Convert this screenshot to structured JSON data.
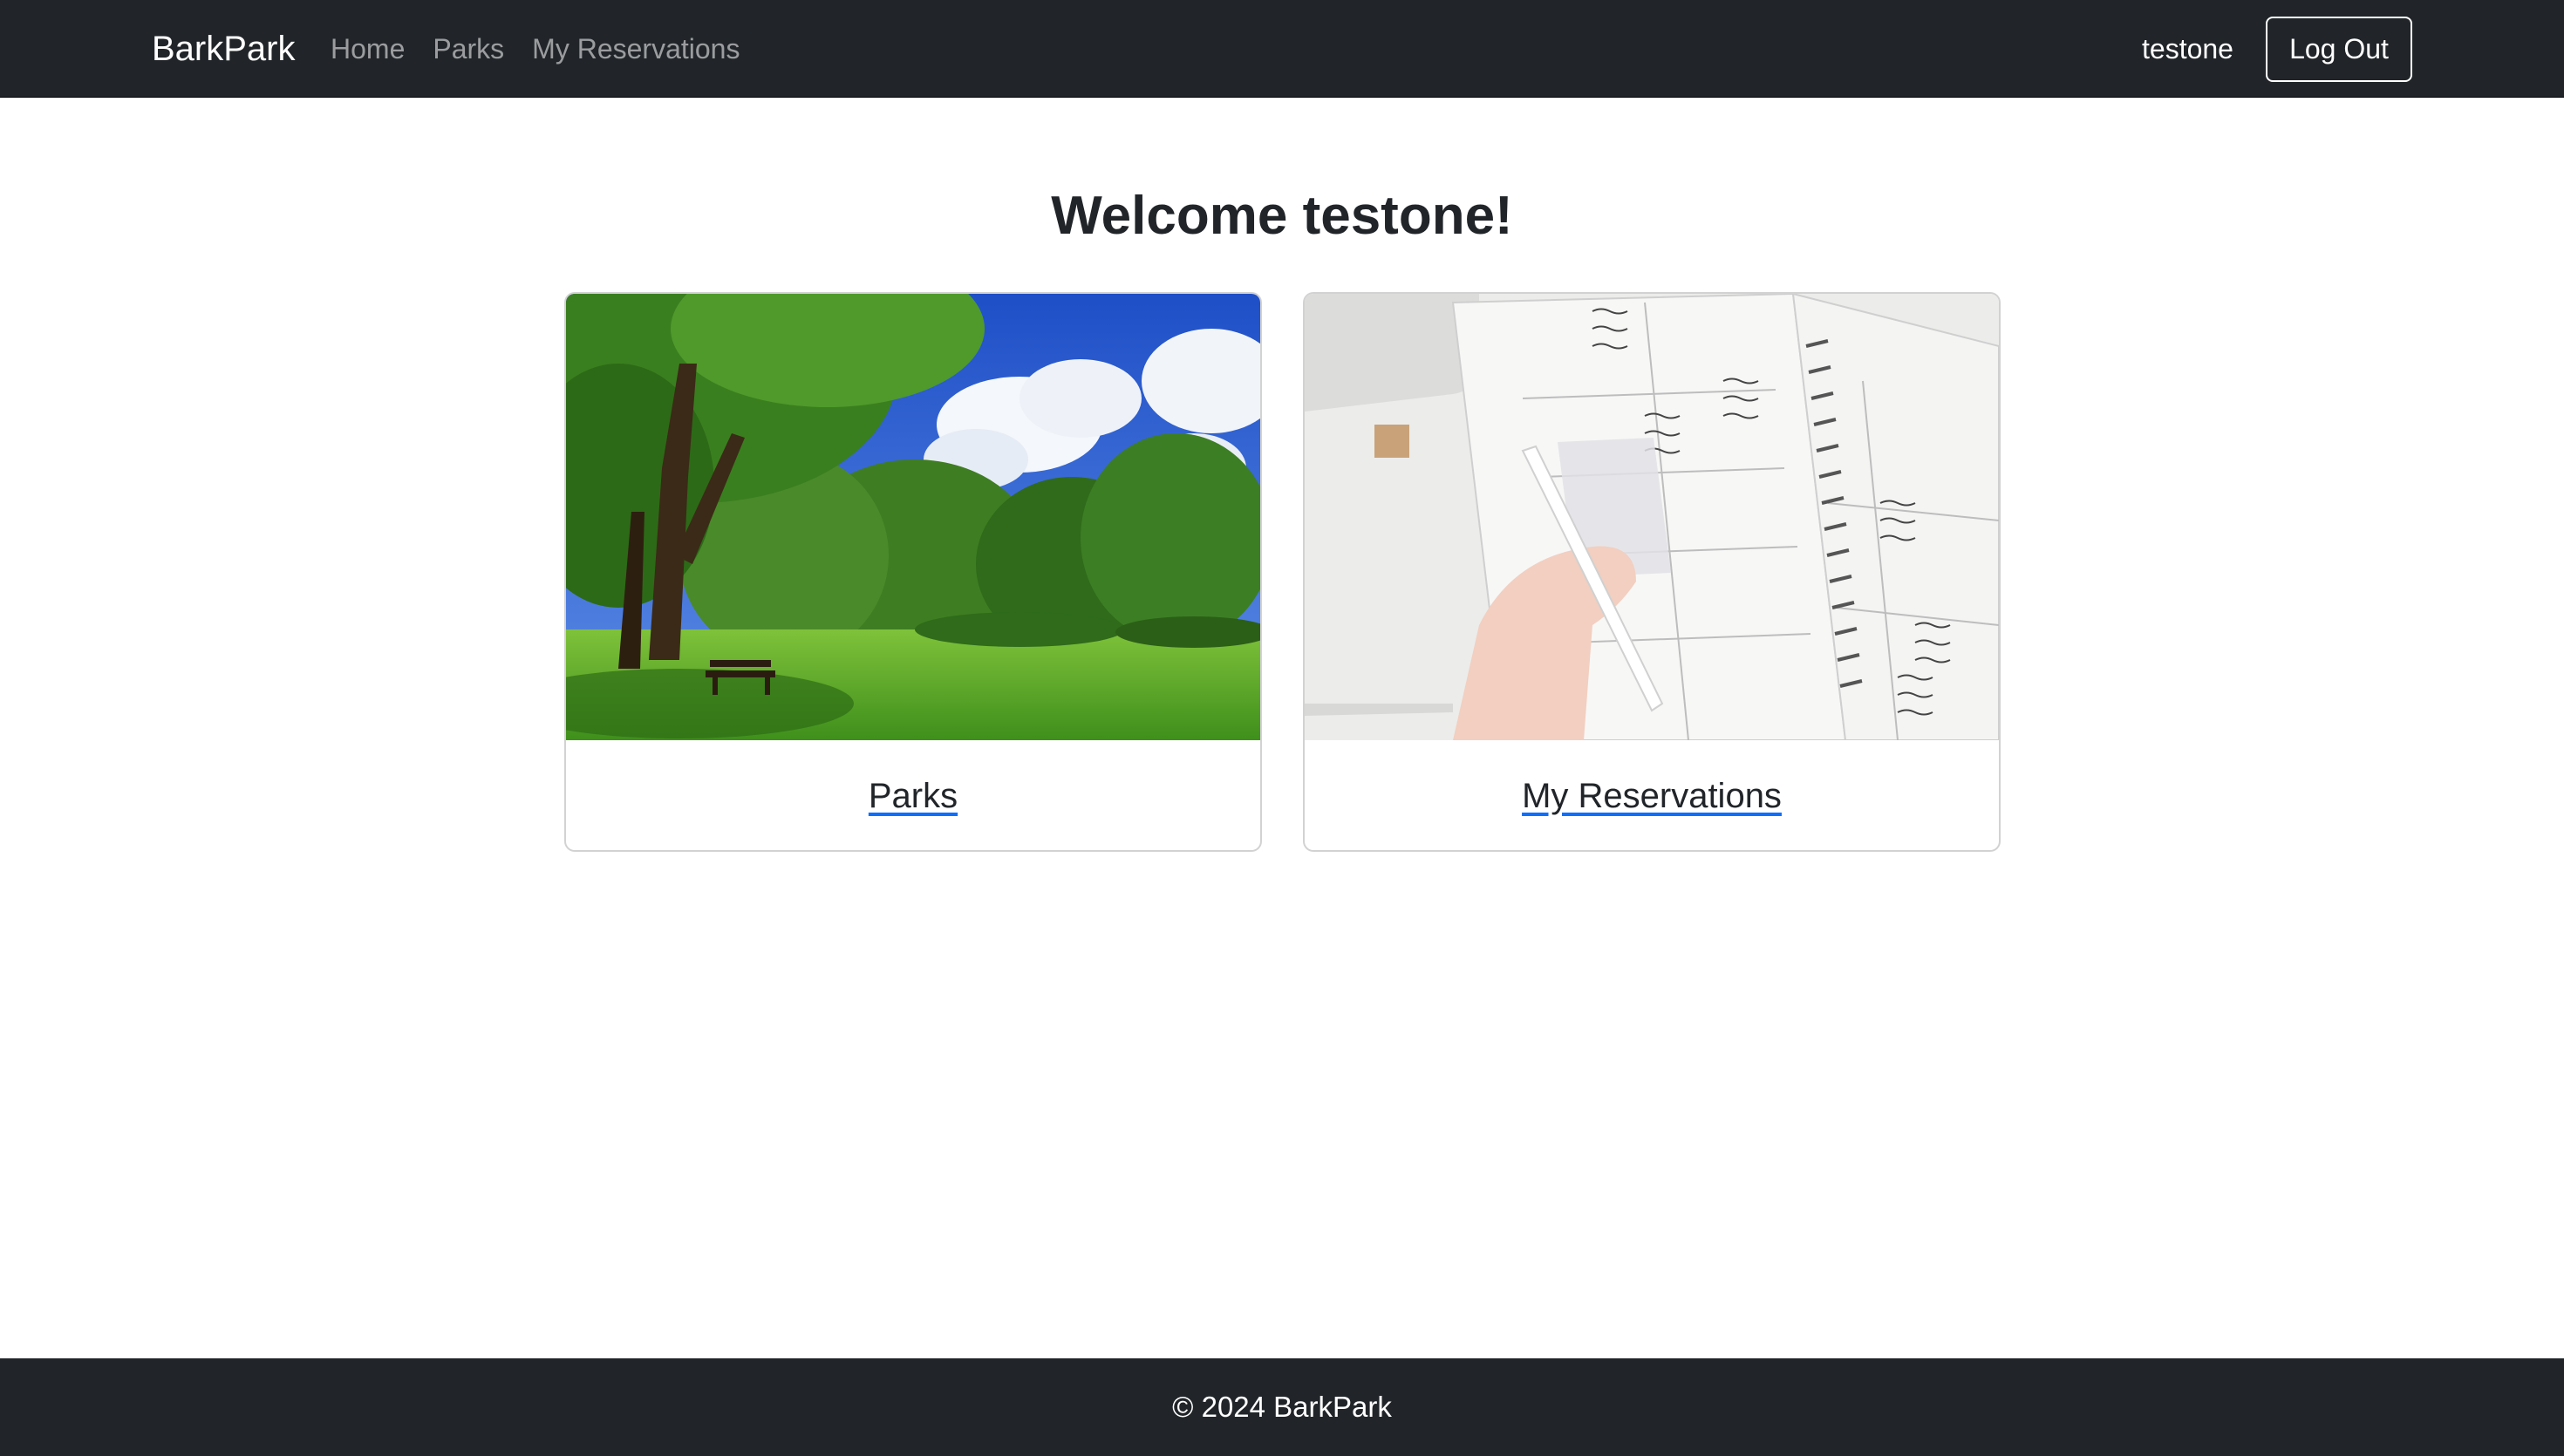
{
  "navbar": {
    "brand": "BarkPark",
    "links": [
      {
        "label": "Home"
      },
      {
        "label": "Parks"
      },
      {
        "label": "My Reservations"
      }
    ],
    "username": "testone",
    "logout_label": "Log Out"
  },
  "main": {
    "title": "Welcome testone!",
    "cards": [
      {
        "label": "Parks",
        "image": "park-photo"
      },
      {
        "label": "My Reservations",
        "image": "planner-photo"
      }
    ]
  },
  "footer": {
    "text": "© 2024 BarkPark"
  },
  "colors": {
    "navbar_bg": "#212529",
    "link_underline": "#0d6efd",
    "text": "#212529"
  }
}
